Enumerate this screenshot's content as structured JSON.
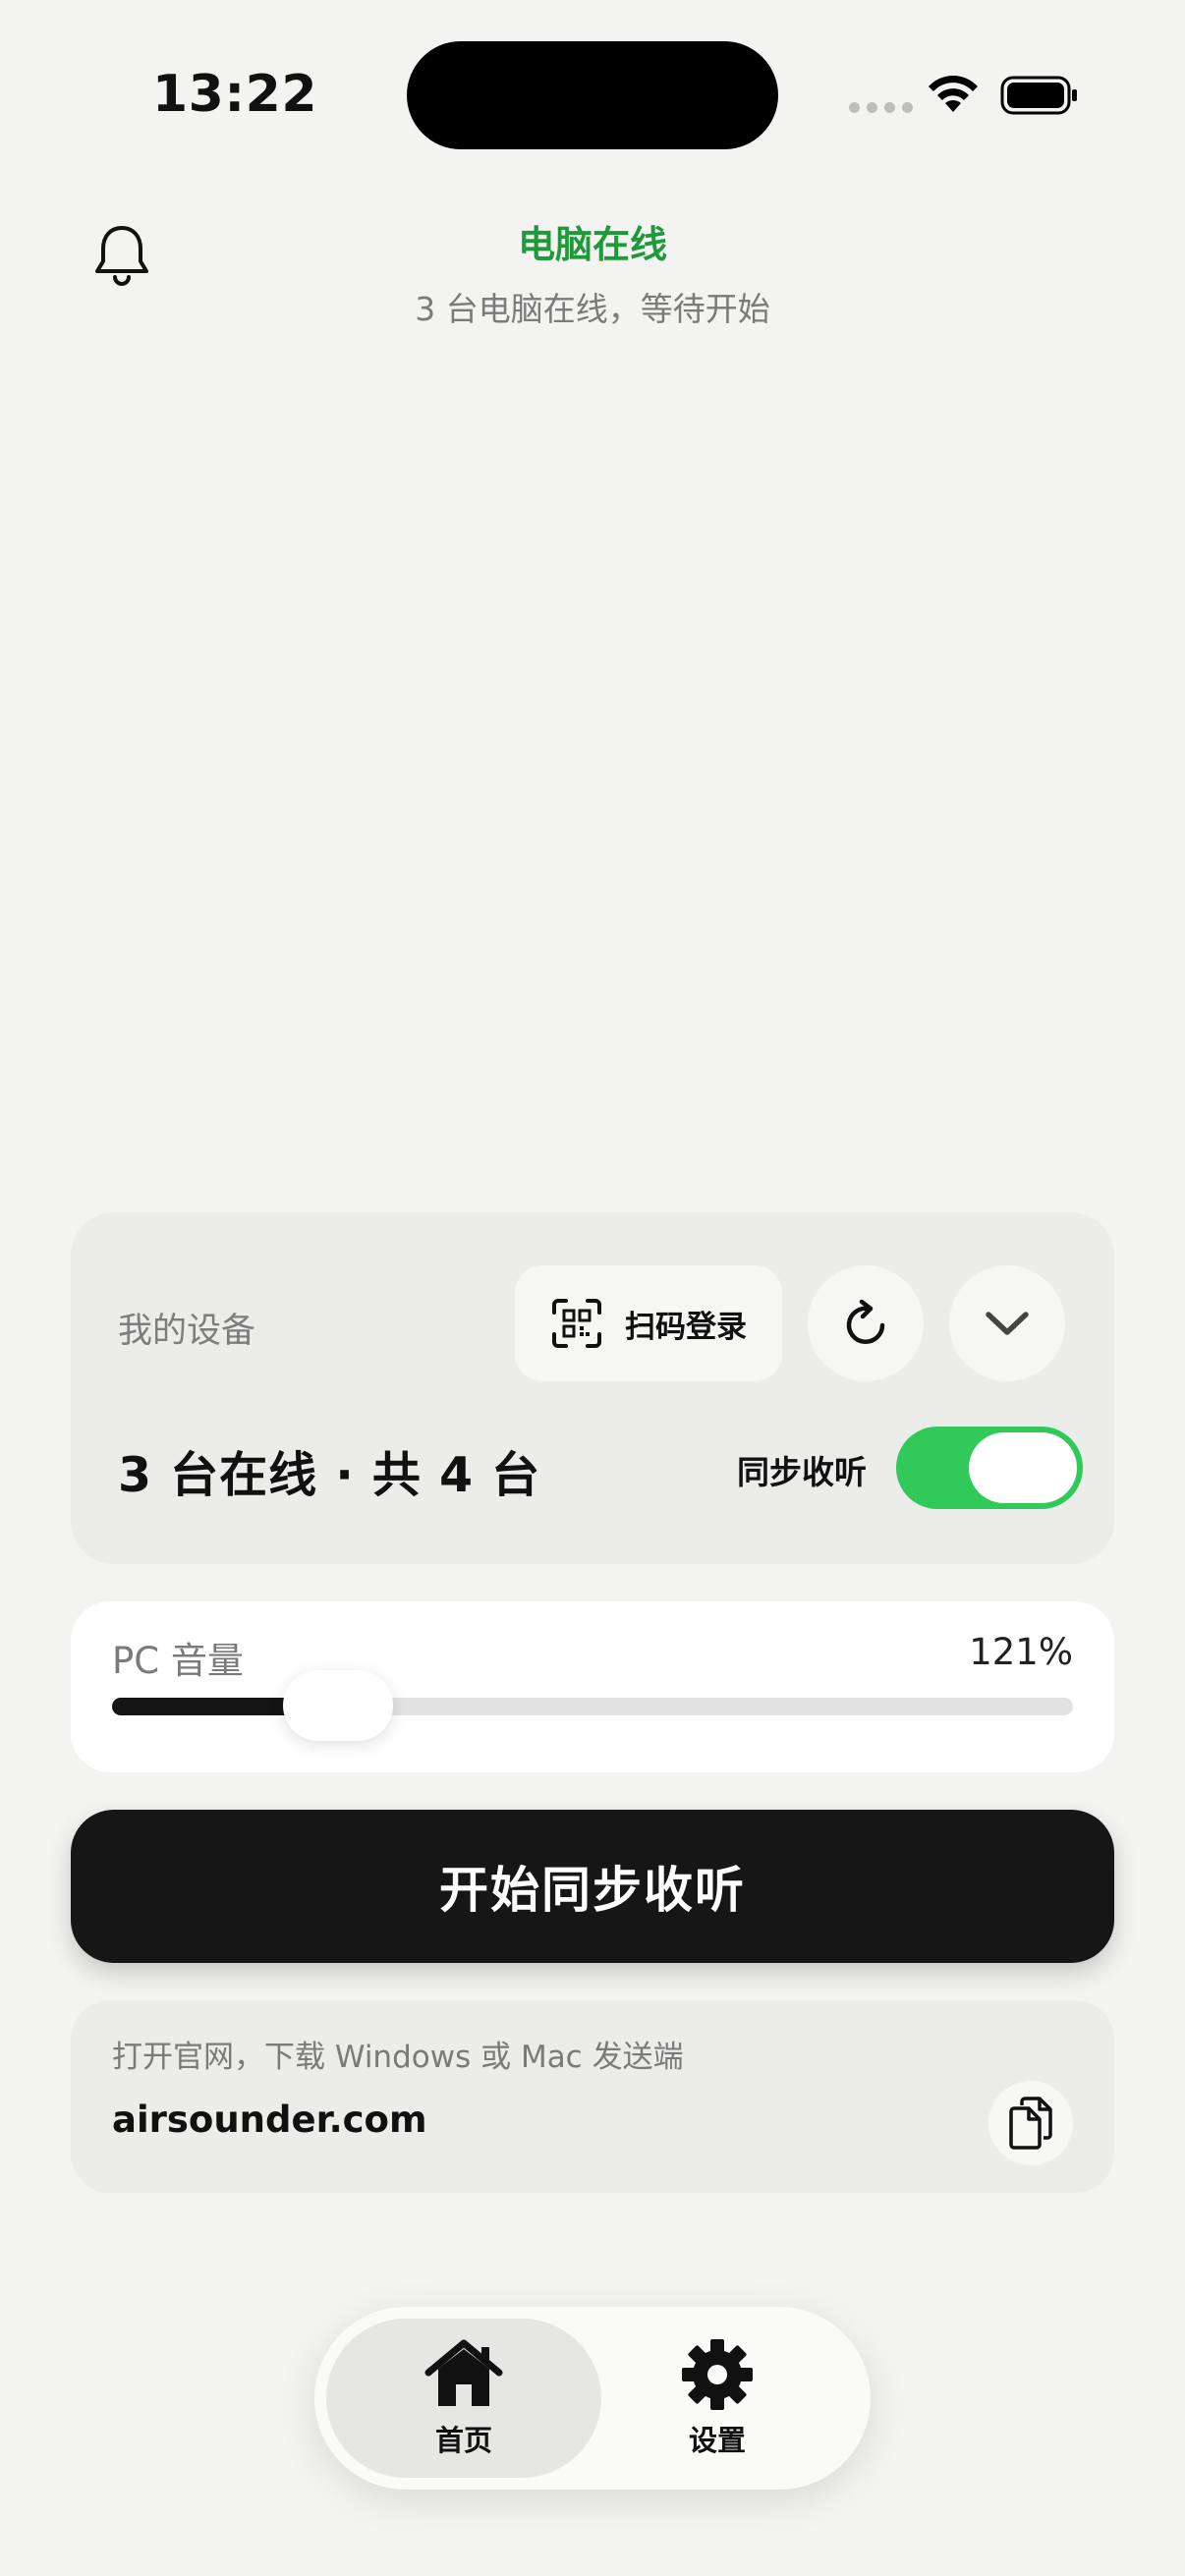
{
  "status_bar": {
    "time": "13:22"
  },
  "header": {
    "title": "电脑在线",
    "subtitle": "3 台电脑在线，等待开始",
    "title_color": "#1f9a3b"
  },
  "device_card": {
    "label": "我的设备",
    "scan_login_label": "扫码登录",
    "count_text": "3 台在线 · 共 4 台",
    "sync_label": "同步收听",
    "sync_enabled": true,
    "toggle_color": "#31c95a"
  },
  "volume": {
    "label": "PC 音量",
    "value_text": "121%",
    "slider_fraction": 0.235
  },
  "start_button": {
    "label": "开始同步收听"
  },
  "website": {
    "hint": "打开官网，下载 Windows 或 Mac 发送端",
    "url": "airsounder.com"
  },
  "tab_bar": {
    "tabs": [
      {
        "label": "首页",
        "icon": "home-icon",
        "active": true
      },
      {
        "label": "设置",
        "icon": "gear-icon",
        "active": false
      }
    ]
  },
  "icons": [
    "bell-icon",
    "qr-code-icon",
    "refresh-icon",
    "chevron-down-icon",
    "copy-icon",
    "home-icon",
    "gear-icon",
    "wifi-icon",
    "battery-icon"
  ]
}
